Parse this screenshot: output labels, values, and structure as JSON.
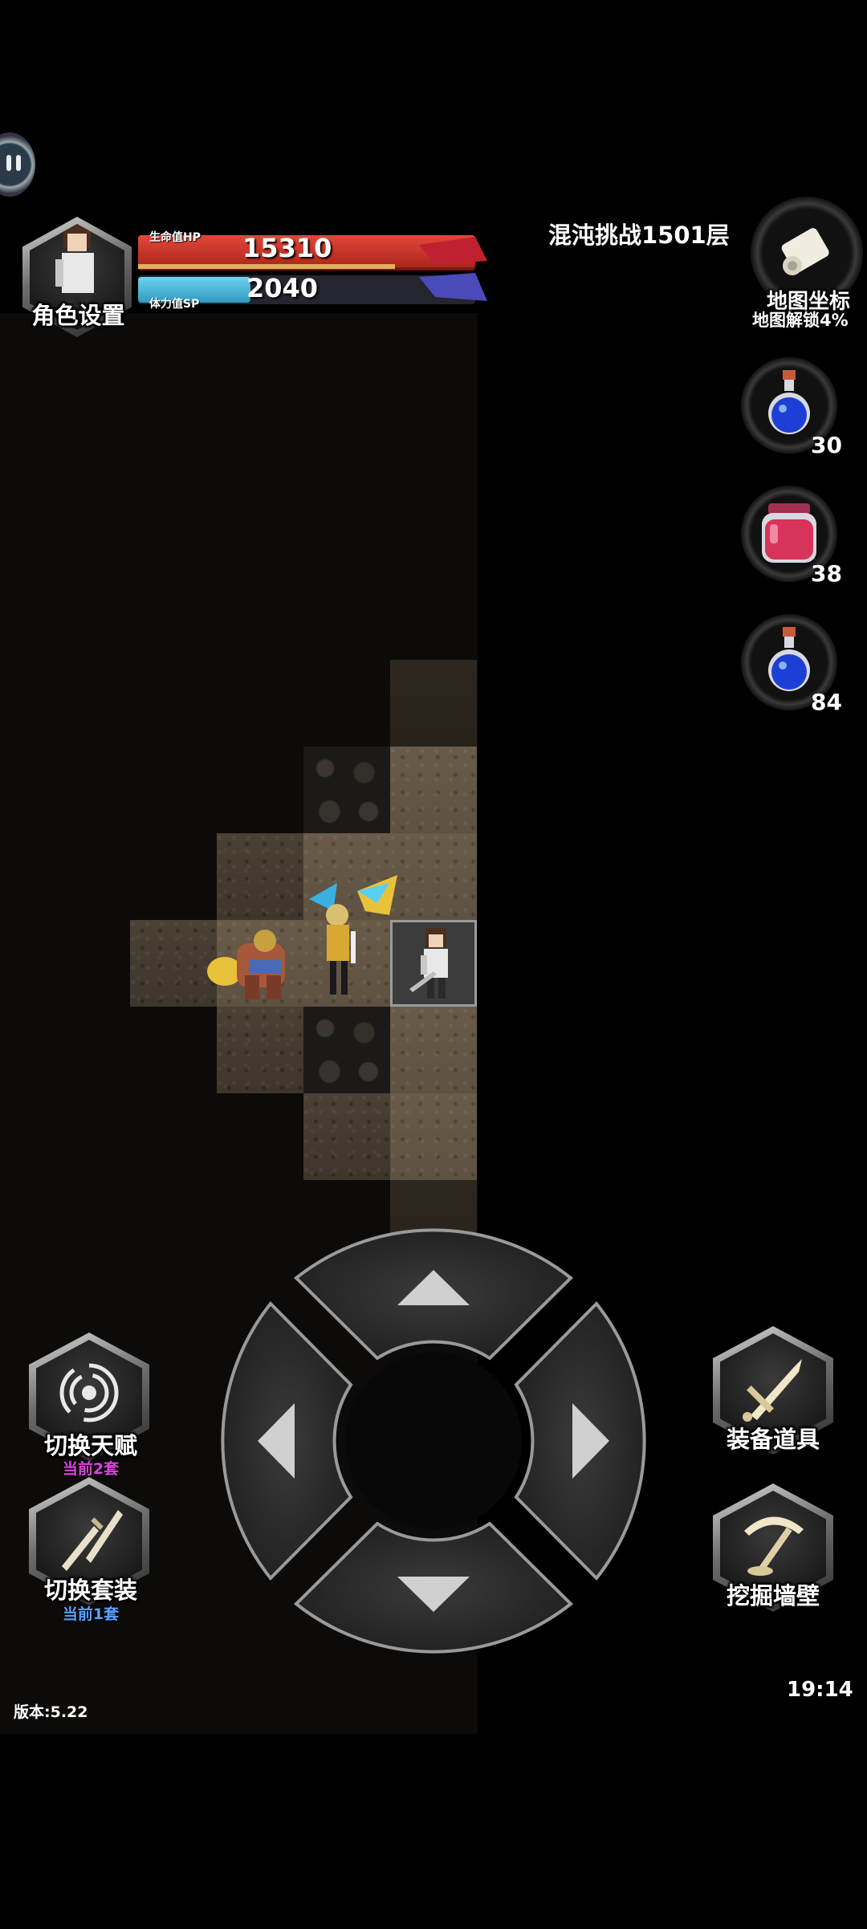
{
  "hud": {
    "character_button": "角色设置",
    "hp_label": "生命值HP",
    "hp_value": "15310",
    "sp_label": "体力值SP",
    "sp_value": "2040",
    "floor_title": "混沌挑战1501层",
    "map_button": "地图坐标",
    "map_unlock": "地图解锁4%"
  },
  "potions": [
    {
      "name": "blue-potion",
      "count": "30",
      "color": "#1e3fd6"
    },
    {
      "name": "red-potion",
      "count": "38",
      "color": "#d8335a"
    },
    {
      "name": "blue-potion",
      "count": "84",
      "color": "#1e3fd6"
    }
  ],
  "left_buttons": {
    "talent_label": "切换天赋",
    "talent_sub": "当前2套",
    "talent_sub_color": "#e040e0",
    "outfit_label": "切换套装",
    "outfit_sub": "当前1套",
    "outfit_sub_color": "#5aa0ff"
  },
  "right_buttons": {
    "equip_label": "装备道具",
    "dig_label": "挖掘墙壁"
  },
  "footer": {
    "version": "版本:5.22",
    "time": "19:14"
  },
  "icons": {
    "pause": "pause-icon",
    "map": "scroll-icon",
    "talent": "vortex-icon",
    "outfit": "daggers-icon",
    "equip": "sword-icon",
    "dig": "pickaxe-icon"
  },
  "colors": {
    "hp_bar": "#d6372a",
    "sp_bar": "#3fb4d8"
  }
}
